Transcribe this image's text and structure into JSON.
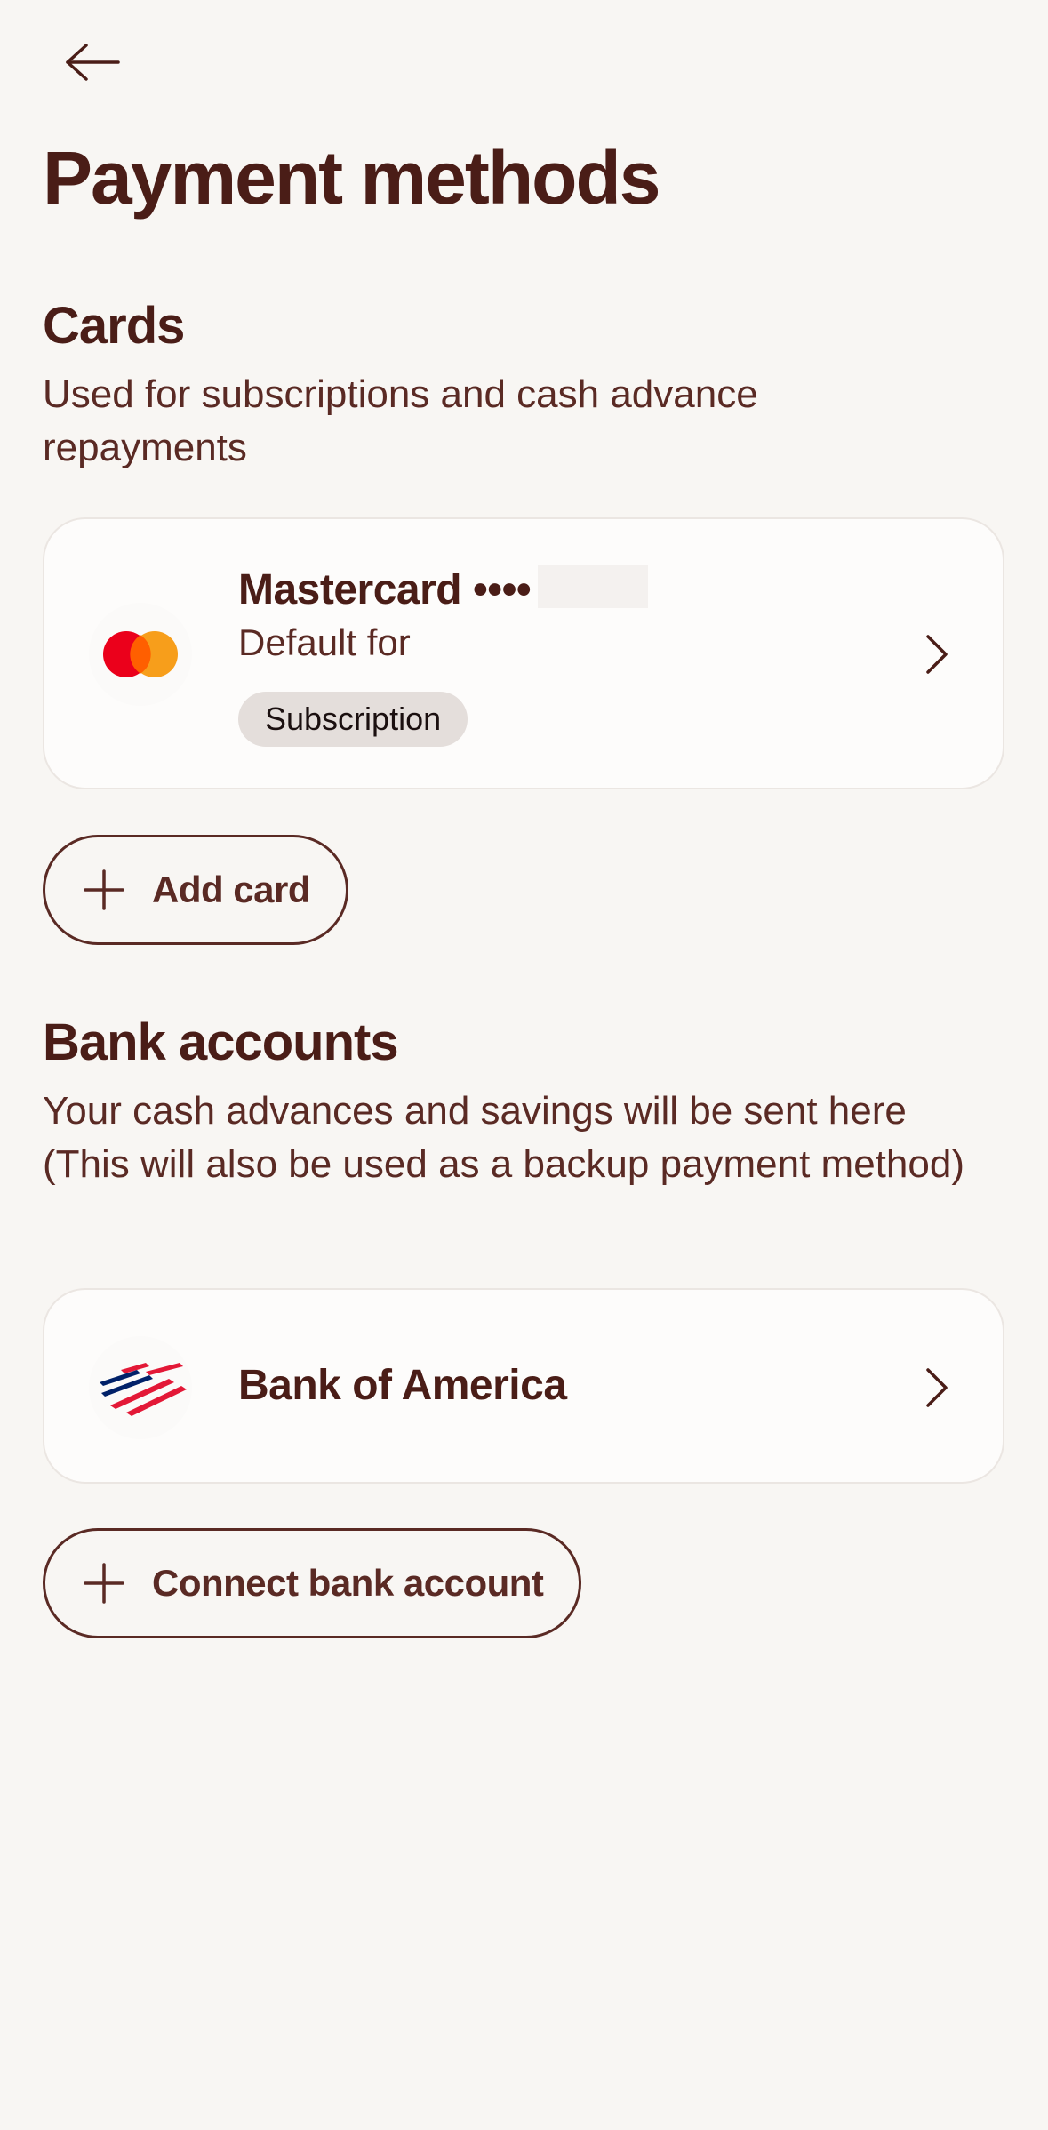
{
  "header": {
    "back_icon": "arrow-left-icon",
    "title": "Payment methods"
  },
  "cards_section": {
    "title": "Cards",
    "description": "Used for subscriptions and cash advance repayments",
    "card": {
      "logo_icon": "mastercard-logo",
      "name": "Mastercard ••••",
      "default_label": "Default for",
      "tag": "Subscription",
      "chevron_icon": "chevron-right-icon"
    },
    "add_button": {
      "icon": "plus-icon",
      "label": "Add card"
    }
  },
  "bank_section": {
    "title": "Bank accounts",
    "description": "Your cash advances and savings will be sent here (This will also be used as a backup payment method)",
    "account": {
      "logo_icon": "bank-of-america-logo",
      "name": "Bank of America",
      "chevron_icon": "chevron-right-icon"
    },
    "connect_button": {
      "icon": "plus-icon",
      "label": "Connect bank account"
    }
  },
  "colors": {
    "background": "#f8f6f3",
    "text_primary": "#4a1d17",
    "card_background": "#fdfcfb",
    "tag_background": "#e4dedb",
    "mastercard_red": "#eb001b",
    "mastercard_orange": "#f79e1b",
    "boa_red": "#e31837",
    "boa_blue": "#012169"
  }
}
